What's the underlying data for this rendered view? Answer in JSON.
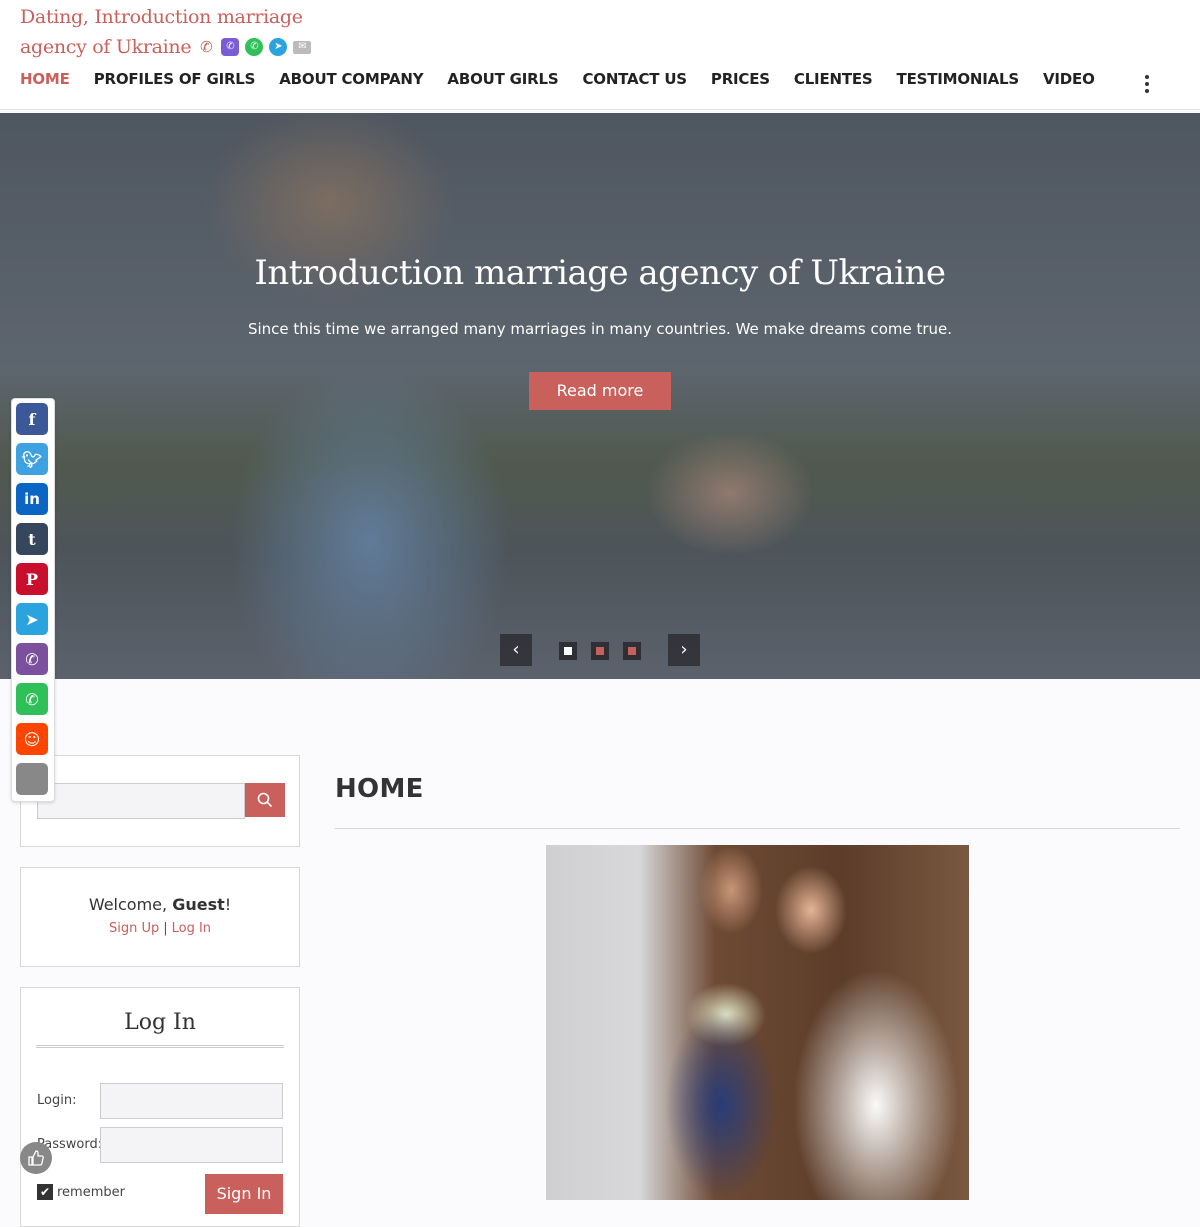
{
  "brand": {
    "line1": "Dating, Introduction marriage",
    "line2": "agency of Ukraine",
    "contact_icons": [
      "phone-icon",
      "viber-icon",
      "whatsapp-icon",
      "telegram-icon",
      "email-icon"
    ]
  },
  "nav": {
    "items": [
      {
        "label": "HOME",
        "active": true
      },
      {
        "label": "PROFILES OF GIRLS"
      },
      {
        "label": "ABOUT COMPANY"
      },
      {
        "label": "ABOUT GIRLS"
      },
      {
        "label": "CONTACT US"
      },
      {
        "label": "PRICES"
      },
      {
        "label": "CLIENTES"
      },
      {
        "label": "TESTIMONIALS"
      },
      {
        "label": "VIDEO"
      }
    ]
  },
  "hero": {
    "title": "Introduction marriage agency of Ukraine",
    "subtitle": "Since this time we arranged many marriages in many countries. We make dreams come true.",
    "button": "Read more",
    "prev": "‹",
    "next": "›",
    "slides": 3,
    "active_slide": 1
  },
  "social": [
    "facebook",
    "twitter",
    "linkedin",
    "tumblr",
    "pinterest",
    "telegram",
    "viber",
    "whatsapp",
    "reddit",
    "more"
  ],
  "sidebar": {
    "search": {
      "placeholder": ""
    },
    "welcome": {
      "prefix": "Welcome, ",
      "name": "Guest",
      "suffix": "!",
      "signup": "Sign Up",
      "separator": "|",
      "login": "Log In"
    },
    "login_form": {
      "title": "Log In",
      "login_label": "Login:",
      "password_label": "Password:",
      "remember_label": "remember",
      "remember_checked": true,
      "submit": "Sign In"
    }
  },
  "main": {
    "title": "HOME"
  },
  "colors": {
    "accent": "#c9605b",
    "text": "#333333",
    "background": "#fbfbfd"
  }
}
